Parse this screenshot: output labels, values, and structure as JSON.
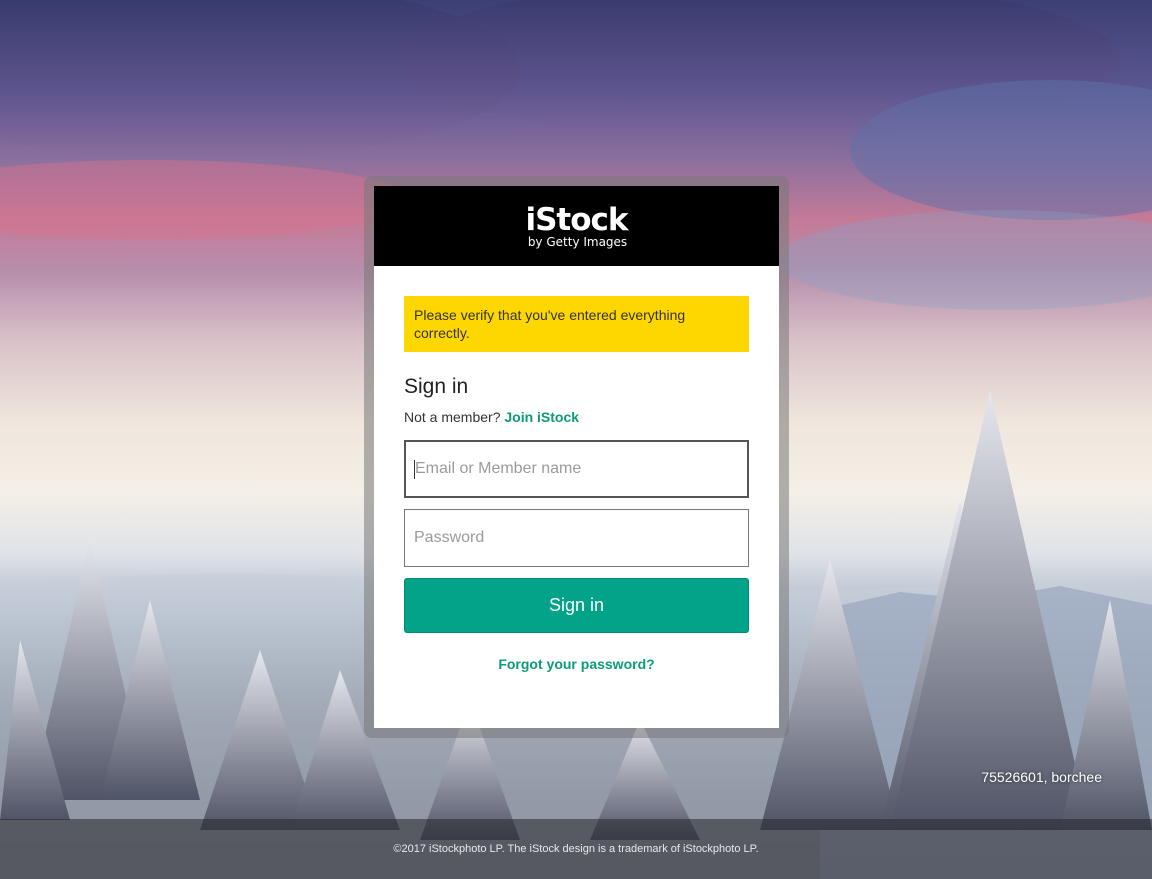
{
  "brand": {
    "name": "iStock",
    "tagline": "by Getty Images"
  },
  "alert": {
    "message": "Please verify that you've entered everything correctly."
  },
  "form": {
    "title": "Sign in",
    "member_prompt": "Not a member?",
    "join_link": "Join iStock",
    "email_placeholder": "Email or Member name",
    "password_placeholder": "Password",
    "submit_label": "Sign in",
    "forgot_link": "Forgot your password?"
  },
  "background": {
    "credit": "75526601, borchee"
  },
  "footer": {
    "copyright": "©2017 iStockphoto LP. The iStock design is a trademark of iStockphoto LP."
  },
  "colors": {
    "accent": "#02a388",
    "link": "#0c9b77",
    "alert": "#ffd700",
    "brand_bar": "#000000"
  }
}
